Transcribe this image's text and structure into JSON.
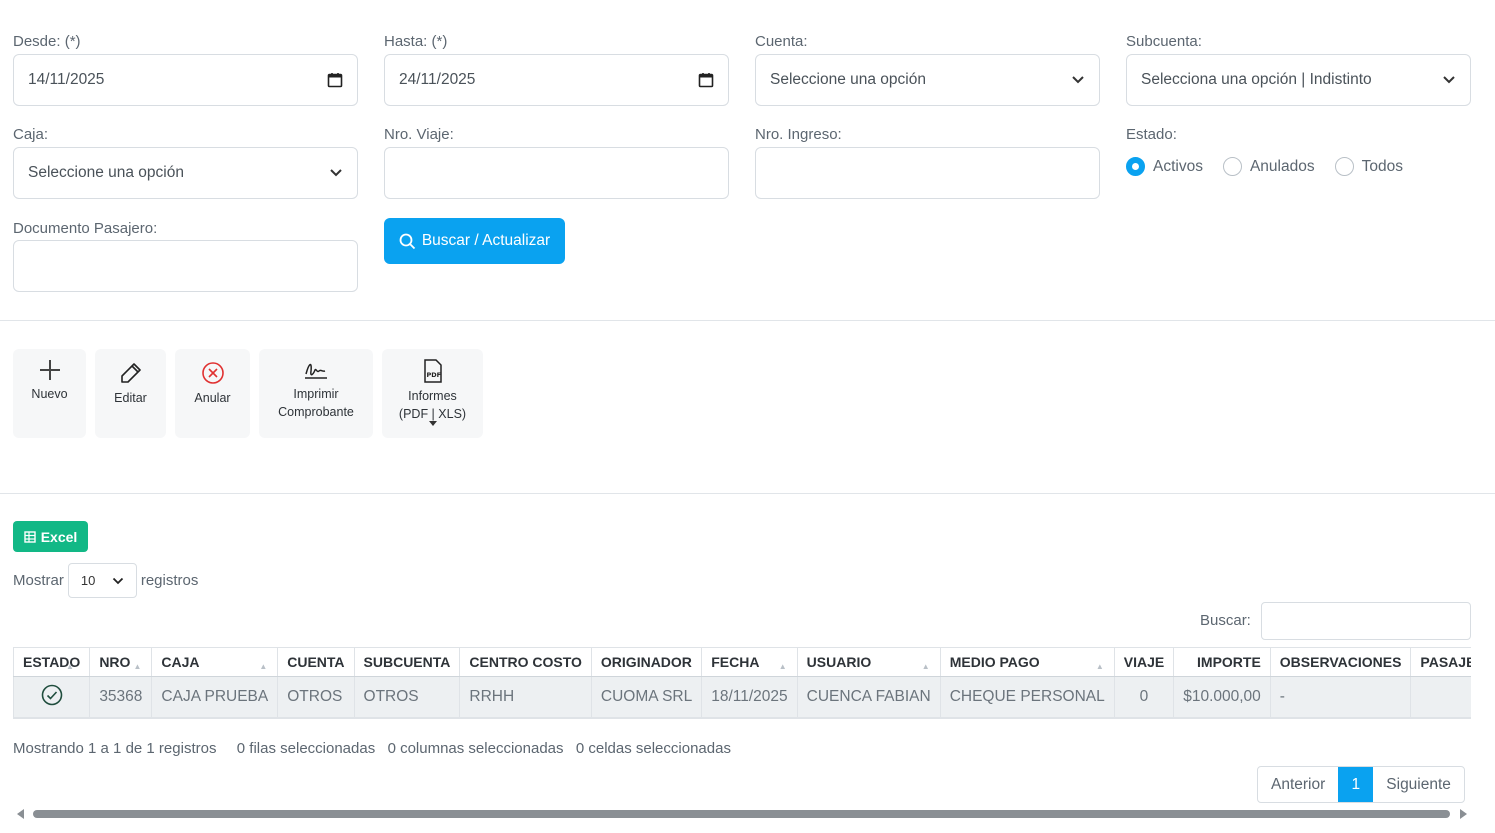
{
  "filters": {
    "desde": {
      "label": "Desde: (*)",
      "value": "14/11/2025"
    },
    "hasta": {
      "label": "Hasta: (*)",
      "value": "24/11/2025"
    },
    "cuenta": {
      "label": "Cuenta:",
      "value": "Seleccione una opción"
    },
    "subcuenta": {
      "label": "Subcuenta:",
      "value": "Selecciona una opción | Indistinto"
    },
    "caja": {
      "label": "Caja:",
      "value": "Seleccione una opción"
    },
    "nro_viaje": {
      "label": "Nro. Viaje:",
      "value": ""
    },
    "nro_ingreso": {
      "label": "Nro. Ingreso:",
      "value": ""
    },
    "estado": {
      "label": "Estado:",
      "options": [
        "Activos",
        "Anulados",
        "Todos"
      ],
      "selected": "Activos"
    },
    "documento": {
      "label": "Documento Pasajero:",
      "value": ""
    },
    "search_button": "Buscar / Actualizar"
  },
  "toolbar": {
    "nuevo": "Nuevo",
    "editar": "Editar",
    "anular": "Anular",
    "imprimir_1": "Imprimir",
    "imprimir_2": "Comprobante",
    "informes_1": "Informes",
    "informes_2": "(PDF | XLS)"
  },
  "table_controls": {
    "excel": "Excel",
    "mostrar": "Mostrar",
    "page_size": "10",
    "registros": "registros",
    "buscar": "Buscar:"
  },
  "table": {
    "columns": [
      "ESTADO",
      "NRO",
      "CAJA",
      "CUENTA",
      "SUBCUENTA",
      "CENTRO COSTO",
      "ORIGINADOR",
      "FECHA",
      "USUARIO",
      "MEDIO PAGO",
      "VIAJE",
      "IMPORTE",
      "OBSERVACIONES",
      "PASAJERO"
    ],
    "rows": [
      {
        "estado": "check",
        "nro": "35368",
        "caja": "CAJA PRUEBA",
        "cuenta": "OTROS",
        "subcuenta": "OTROS",
        "centro_costo": "RRHH",
        "originador": "CUOMA SRL",
        "fecha": "18/11/2025",
        "usuario": "CUENCA FABIAN",
        "medio_pago": "CHEQUE PERSONAL",
        "viaje": "0",
        "importe": "$10.000,00",
        "observaciones": "-",
        "pasajero": ""
      }
    ]
  },
  "footer": {
    "info": "Mostrando 1 a 1 de 1 registros",
    "filas": "0 filas seleccionadas",
    "columnas": "0 columnas seleccionadas",
    "celdas": "0 celdas seleccionadas",
    "anterior": "Anterior",
    "page": "1",
    "siguiente": "Siguiente"
  },
  "colors": {
    "accent": "#0aa2f0",
    "excel": "#12b886",
    "danger": "#e03131"
  }
}
